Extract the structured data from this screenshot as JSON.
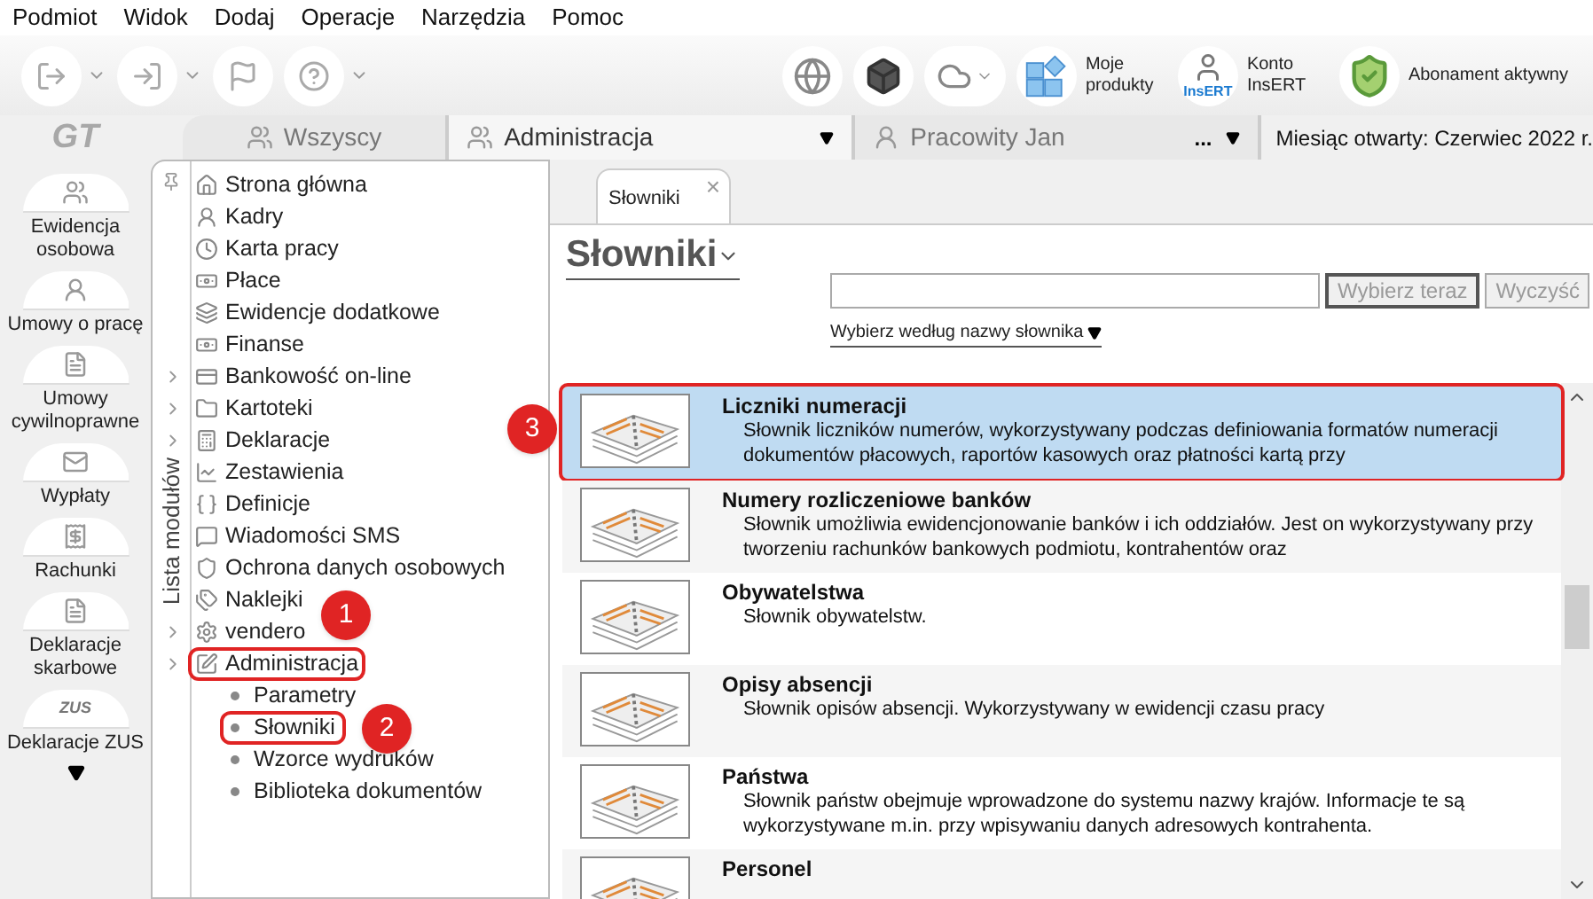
{
  "menu": [
    "Podmiot",
    "Widok",
    "Dodaj",
    "Operacje",
    "Narzędzia",
    "Pomoc"
  ],
  "toolbar": {
    "right_buttons": [
      {
        "kind": "products",
        "label": "Moje produkty"
      },
      {
        "kind": "account",
        "label": "Konto InsERT"
      },
      {
        "kind": "subscription",
        "label": "Abonament aktywny"
      }
    ],
    "account_logo": "InsERT"
  },
  "logo": "GT",
  "tabs": [
    {
      "label": "Wszyscy",
      "kind": "group",
      "dots": false,
      "selected": false
    },
    {
      "label": "Administracja",
      "kind": "group",
      "dots": false,
      "selected": true
    },
    {
      "label": "Pracowity Jan",
      "kind": "person",
      "dots": true,
      "selected": false
    }
  ],
  "dots_label": "...",
  "month_status": "Miesiąc otwarty:  Czerwiec 2022 r.",
  "rail": [
    {
      "label": "Ewidencja osobowa"
    },
    {
      "label": "Umowy o pracę"
    },
    {
      "label": "Umowy cywilnoprawne"
    },
    {
      "label": "Wypłaty"
    },
    {
      "label": "Rachunki"
    },
    {
      "label": "Deklaracje skarbowe"
    },
    {
      "label": "Deklaracje ZUS",
      "badge": "ZUS"
    }
  ],
  "module_list_label": "Lista modułów",
  "tree": [
    {
      "label": "Strona główna",
      "expandable": false,
      "highlighted": false
    },
    {
      "label": "Kadry",
      "expandable": false,
      "highlighted": false
    },
    {
      "label": "Karta pracy",
      "expandable": false,
      "highlighted": false
    },
    {
      "label": "Płace",
      "expandable": false,
      "highlighted": false
    },
    {
      "label": "Ewidencje dodatkowe",
      "expandable": false,
      "highlighted": false
    },
    {
      "label": "Finanse",
      "expandable": false,
      "highlighted": false
    },
    {
      "label": "Bankowość on-line",
      "expandable": true,
      "highlighted": false
    },
    {
      "label": "Kartoteki",
      "expandable": true,
      "highlighted": false
    },
    {
      "label": "Deklaracje",
      "expandable": true,
      "highlighted": false
    },
    {
      "label": "Zestawienia",
      "expandable": false,
      "highlighted": false
    },
    {
      "label": "Definicje",
      "expandable": false,
      "highlighted": false
    },
    {
      "label": "Wiadomości SMS",
      "expandable": false,
      "highlighted": false
    },
    {
      "label": "Ochrona danych osobowych",
      "expandable": false,
      "highlighted": false
    },
    {
      "label": "Naklejki",
      "expandable": false,
      "highlighted": false,
      "callout": "1"
    },
    {
      "label": "vendero",
      "expandable": true,
      "highlighted": false
    },
    {
      "label": "Administracja",
      "expandable": true,
      "highlighted": true,
      "children": [
        {
          "label": "Parametry",
          "highlighted": false
        },
        {
          "label": "Słowniki",
          "highlighted": true,
          "callout": "2"
        },
        {
          "label": "Wzorce wydruków",
          "highlighted": false
        },
        {
          "label": "Biblioteka dokumentów",
          "highlighted": false
        }
      ]
    }
  ],
  "doc_tab": {
    "label": "Słowniki",
    "close": "×"
  },
  "page_title": "Słowniki",
  "buttons": [
    {
      "label": "Wybierz teraz",
      "default": true
    },
    {
      "label": "Wyczyść",
      "default": false
    }
  ],
  "filter_link": "Wybierz według nazwy słownika",
  "list_callout": "3",
  "dictionaries": [
    {
      "title": "Liczniki numeracji",
      "description": "Słownik liczników numerów, wykorzystywany podczas definiowania formatów numeracji dokumentów płacowych, raportów kasowych oraz płatności kartą przy",
      "selected": true
    },
    {
      "title": "Numery rozliczeniowe banków",
      "description": "Słownik umożliwia ewidencjonowanie banków i ich oddziałów. Jest on wykorzystywany przy tworzeniu rachunków bankowych podmiotu, kontrahentów oraz",
      "selected": false
    },
    {
      "title": "Obywatelstwa",
      "description": "Słownik obywatelstw.",
      "selected": false
    },
    {
      "title": "Opisy absencji",
      "description": "Słownik opisów absencji. Wykorzystywany w ewidencji czasu pracy",
      "selected": false
    },
    {
      "title": "Państwa",
      "description": "Słownik państw obejmuje wprowadzone do systemu nazwy krajów. Informacje te są wykorzystywane m.in. przy wpisywaniu danych adresowych kontrahenta.",
      "selected": false
    },
    {
      "title": "Personel",
      "selected": false
    }
  ]
}
